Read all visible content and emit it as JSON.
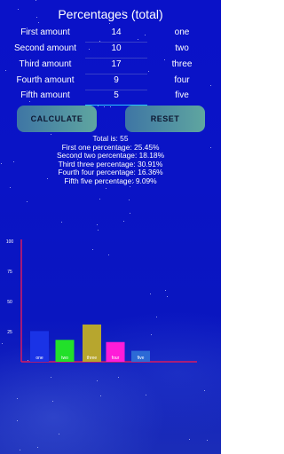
{
  "title": "Percentages (total)",
  "inputs": [
    {
      "label": "First amount",
      "value": "14",
      "name": "one"
    },
    {
      "label": "Second amount",
      "value": "10",
      "name": "two"
    },
    {
      "label": "Third amount",
      "value": "17",
      "name": "three"
    },
    {
      "label": "Fourth amount",
      "value": "9",
      "name": "four"
    },
    {
      "label": "Fifth amount",
      "value": "5",
      "name": "five"
    }
  ],
  "buttons": {
    "calculate": "CALCULATE",
    "reset": "RESET"
  },
  "results": {
    "total": "Total is: 55",
    "lines": [
      "First one percentage: 25.45%",
      "Second two percentage: 18.18%",
      "Third three percentage: 30.91%",
      "Fourth four percentage: 16.36%",
      "Fifth five percentage: 9.09%"
    ]
  },
  "colors": {
    "background": "#0a14c6",
    "button": "#4f8fa2",
    "axis": "#d81b60",
    "bars": [
      "#1a33e6",
      "#22e02a",
      "#b7a62e",
      "#ff1cd8",
      "#2c6ad6"
    ]
  },
  "chart_data": {
    "type": "bar",
    "categories": [
      "one",
      "two",
      "three",
      "four",
      "five"
    ],
    "values": [
      25.45,
      18.18,
      30.91,
      16.36,
      9.09
    ],
    "ylim": [
      0,
      100
    ],
    "yticks": [
      "100",
      "75",
      "50",
      "25"
    ],
    "grid": false,
    "legend": "none"
  }
}
